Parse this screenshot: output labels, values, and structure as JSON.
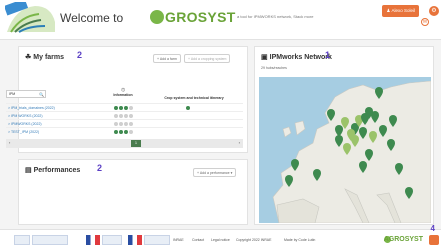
{
  "header": {
    "welcome": "Welcome to",
    "brand": "GROSYST",
    "tagline": "a tool for IPMWORKS network, Stack more",
    "user_button": "Alexo Soleil",
    "mail_icon": "mail-icon",
    "help_icon": "help-icon",
    "settings_icon": "settings-icon"
  },
  "farms": {
    "title": "My farms",
    "annotation": "2",
    "add_farm": "+ Add a farm",
    "add_cropping": "+ Add a cropping system",
    "search_value": "IPM",
    "col_info": "Information",
    "col_crop": "Crop system and technical itinerary",
    "rows": [
      {
        "label": "> IPM_trials_domaines (2022)",
        "dots": [
          "g",
          "g",
          "g",
          "l"
        ],
        "crop": true
      },
      {
        "label": "> IPM WORKS (2022)",
        "dots": [
          "l",
          "l",
          "l",
          "l"
        ],
        "crop": false
      },
      {
        "label": "> IPMWORKS (2022)",
        "dots": [
          "l",
          "l",
          "l",
          "l"
        ],
        "crop": false
      },
      {
        "label": "> TEST_IPM (2022)",
        "dots": [
          "g",
          "g",
          "g",
          "l"
        ],
        "crop": false
      }
    ],
    "page": "1"
  },
  "performances": {
    "title": "Performances",
    "annotation": "2",
    "add": "+ Add a performance"
  },
  "network": {
    "title": "IPMworks Network",
    "annotation": "1",
    "subtitle": "29 hubs/reaches"
  },
  "footer": {
    "links": [
      "INRAE",
      "Contact",
      "Legal notice",
      "Copyright 2022 INRAE",
      "Made by Code Lutin"
    ],
    "brand": "AGROSYST",
    "annotation": "4"
  },
  "colors": {
    "accent": "#e8733a",
    "brand": "#6aa338",
    "annotation": "#5b3fc4",
    "pin_dark": "#3e8a4f",
    "pin_light": "#9bc36a"
  }
}
